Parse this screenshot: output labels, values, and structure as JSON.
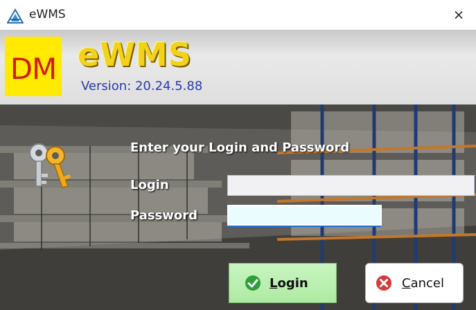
{
  "window": {
    "title": "eWMS",
    "close_glyph": "×"
  },
  "header": {
    "logo_text": "DM",
    "app_name": "eWMS",
    "version": "Version: 20.24.5.88"
  },
  "form": {
    "prompt": "Enter your Login and Password",
    "login_label": "Login",
    "password_label": "Password",
    "login_value": "",
    "password_value": ""
  },
  "buttons": {
    "login": {
      "first": "L",
      "rest": "ogin"
    },
    "cancel": {
      "first": "C",
      "rest": "ancel"
    }
  },
  "icons": {
    "app": "app-logo-icon",
    "keys": "keys-icon",
    "login": "check-icon",
    "cancel": "cancel-icon"
  },
  "colors": {
    "logo_bg": "#ffea00",
    "logo_text": "#d01c1c",
    "app_name": "#f2d21b",
    "version": "#2a3aa8",
    "login_button": "#b8eeae",
    "check": "#2e9e3a",
    "cancel_icon": "#d9383a",
    "focus": "#1e6fd8"
  }
}
